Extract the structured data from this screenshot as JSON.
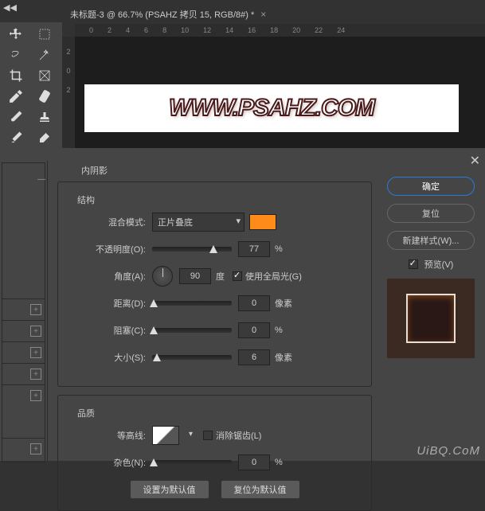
{
  "doc_tab": {
    "title": "未标题-3 @ 66.7% (PSAHZ 拷贝 15, RGB/8#) *",
    "close": "×"
  },
  "ruler_h": [
    "0",
    "2",
    "4",
    "6",
    "8",
    "10",
    "12",
    "14",
    "16",
    "18",
    "20",
    "22",
    "24"
  ],
  "ruler_v": [
    "2",
    "0",
    "2"
  ],
  "canvas": {
    "watermark": "WWW.PSAHZ.COM"
  },
  "dialog": {
    "title": "内阴影",
    "structure_title": "结构",
    "blend_mode": {
      "label": "混合模式:",
      "value": "正片叠底",
      "swatch": "#ff8c1a"
    },
    "opacity": {
      "label": "不透明度(O):",
      "value": "77",
      "unit": "%",
      "pos": 77
    },
    "angle": {
      "label": "角度(A):",
      "value": "90",
      "unit": "度",
      "global": "使用全局光(G)"
    },
    "distance": {
      "label": "距离(D):",
      "value": "0",
      "unit": "像素",
      "pos": 0
    },
    "choke": {
      "label": "阻塞(C):",
      "value": "0",
      "unit": "%",
      "pos": 0
    },
    "size": {
      "label": "大小(S):",
      "value": "6",
      "unit": "像素",
      "pos": 6
    },
    "quality_title": "品质",
    "contour": {
      "label": "等高线:",
      "antialias": "消除锯齿(L)"
    },
    "noise": {
      "label": "杂色(N):",
      "value": "0",
      "unit": "%",
      "pos": 0
    },
    "set_default": "设置为默认值",
    "reset_default": "复位为默认值"
  },
  "right": {
    "ok": "确定",
    "reset": "复位",
    "new_style": "新建样式(W)...",
    "preview": "预览(V)"
  },
  "watermark": "UiBQ.CoM"
}
